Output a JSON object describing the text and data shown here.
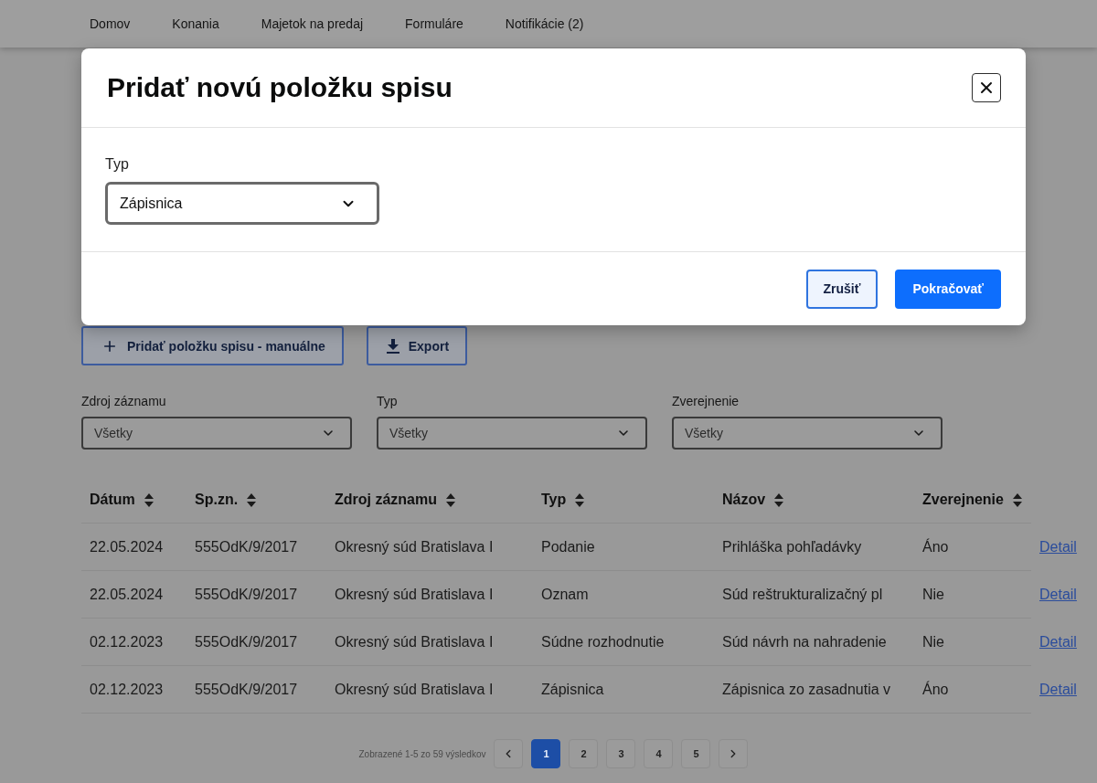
{
  "nav": {
    "items": [
      "Domov",
      "Konania",
      "Majetok na predaj",
      "Formuláre",
      "Notifikácie (2)"
    ]
  },
  "actions": [
    {
      "label": "Pridať položku spisu - manuálne",
      "kind": "add"
    },
    {
      "label": "Export",
      "kind": "export"
    }
  ],
  "filters": [
    {
      "label": "Zdroj záznamu",
      "value": "Všetky"
    },
    {
      "label": "Typ",
      "value": "Všetky"
    },
    {
      "label": "Zverejnenie",
      "value": "Všetky"
    }
  ],
  "table": {
    "columns": [
      "Dátum",
      "Sp.zn.",
      "Zdroj záznamu",
      "Typ",
      "Názov",
      "Zverejnenie"
    ],
    "rows": [
      {
        "cells": [
          "22.05.2024",
          "555OdK/9/2017",
          "Okresný súd Bratislava I",
          "Podanie",
          "Prihláška pohľadávky",
          "Áno"
        ],
        "link": "Detail"
      },
      {
        "cells": [
          "22.05.2024",
          "555OdK/9/2017",
          "Okresný súd Bratislava I",
          "Oznam",
          "Súd reštrukturalizačný pl",
          "Nie"
        ],
        "link": "Detail"
      },
      {
        "cells": [
          "02.12.2023",
          "555OdK/9/2017",
          "Okresný súd Bratislava I",
          "Súdne rozhodnutie",
          "Súd návrh na nahradenie",
          "Nie"
        ],
        "link": "Detail"
      },
      {
        "cells": [
          "02.12.2023",
          "555OdK/9/2017",
          "Okresný súd Bratislava I",
          "Zápisnica",
          "Zápisnica zo zasadnutia v",
          "Áno"
        ],
        "link": "Detail"
      }
    ]
  },
  "pagination": {
    "summary": "Zobrazené 1-5 zo 59 výsledkov",
    "pages": [
      {
        "label": "1",
        "selected": true
      },
      {
        "label": "2",
        "selected": false
      },
      {
        "label": "3",
        "selected": false
      },
      {
        "label": "4",
        "selected": false
      },
      {
        "label": "5",
        "selected": false
      }
    ]
  },
  "dialog": {
    "title": "Pridať novú položku spisu",
    "field": {
      "label": "Typ",
      "value": "Zápisnica"
    },
    "buttons": [
      {
        "label": "Zrušiť",
        "kind": "secondary"
      },
      {
        "label": "Pokračovať",
        "kind": "primary"
      }
    ]
  }
}
